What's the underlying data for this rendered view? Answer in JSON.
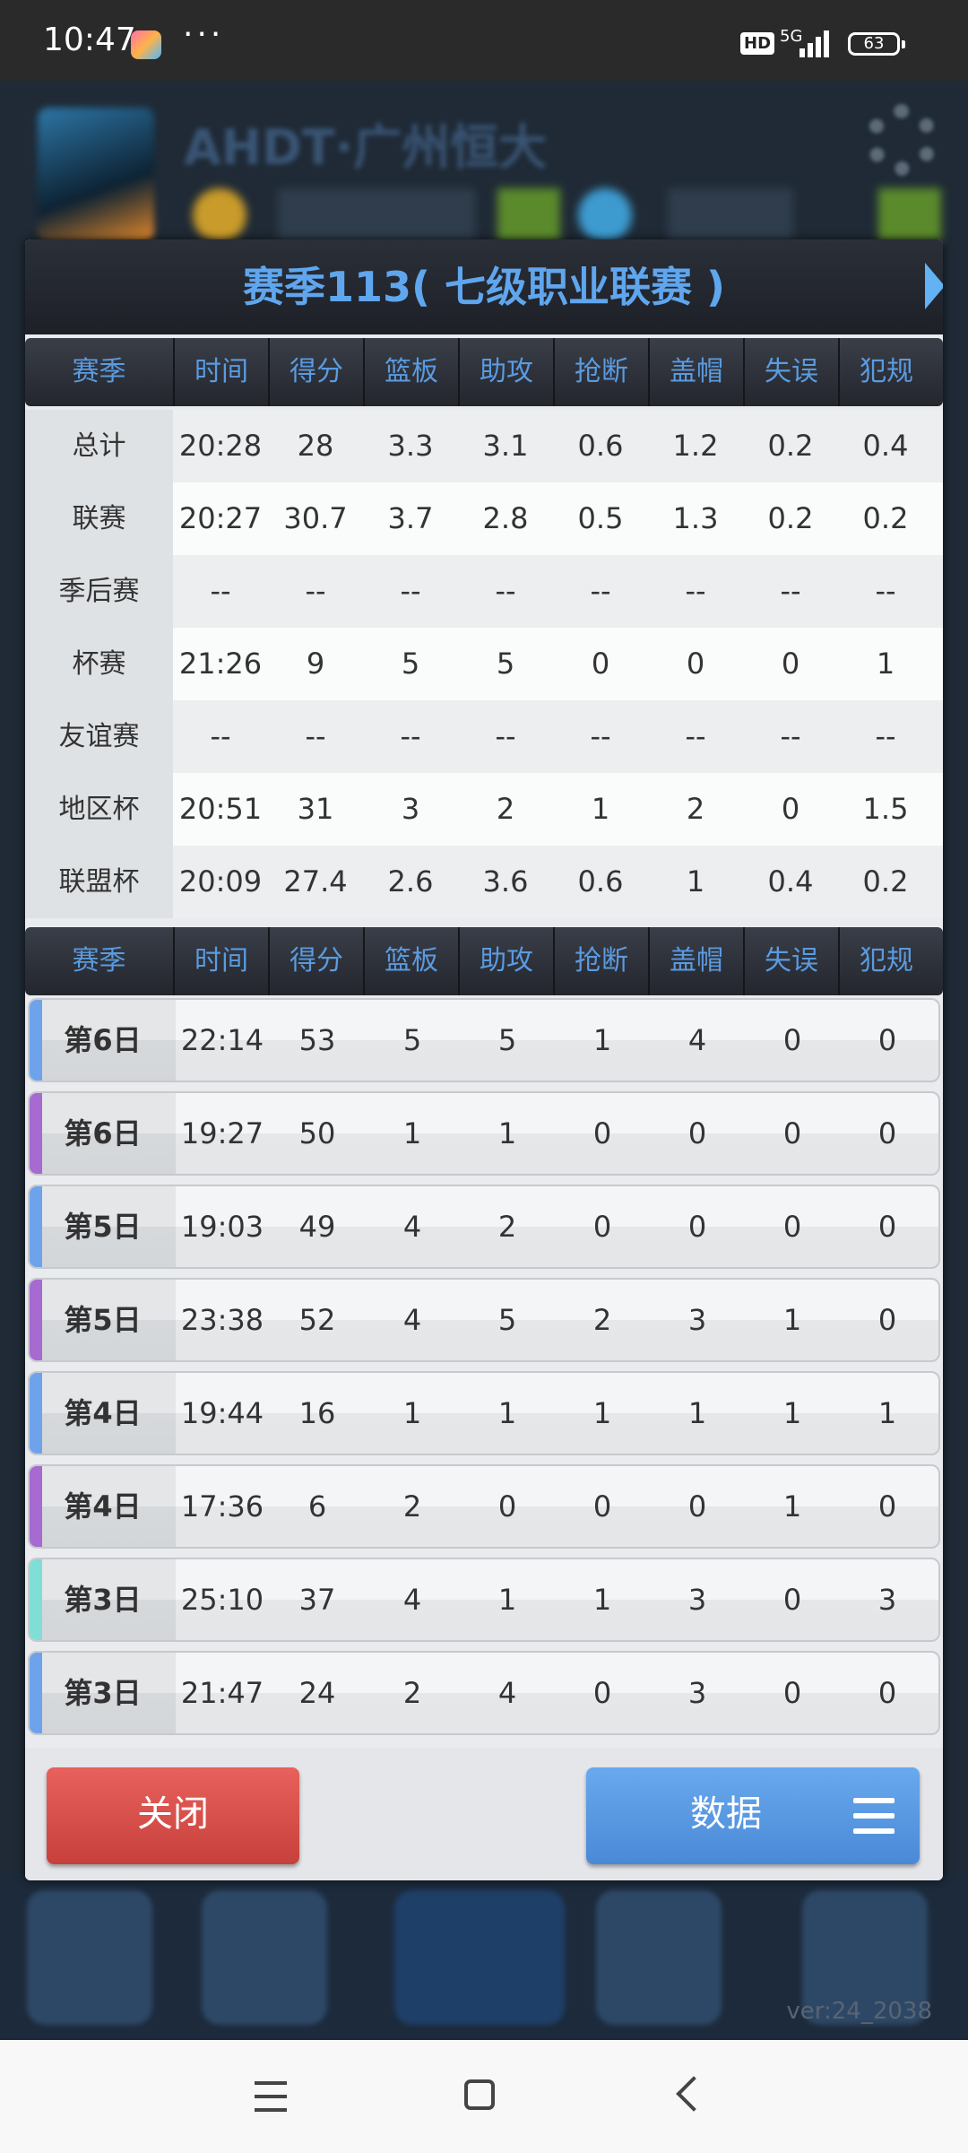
{
  "status_bar": {
    "time": "10:47",
    "dots": "···",
    "hd": "HD",
    "network": "5G",
    "battery": "63"
  },
  "background": {
    "team_title": "AHDT·广州恒大",
    "version": "ver:24_2038"
  },
  "dialog": {
    "title": "赛季113( 七级职业联赛 )",
    "columns": [
      "赛季",
      "时间",
      "得分",
      "篮板",
      "助攻",
      "抢断",
      "盖帽",
      "失误",
      "犯规"
    ],
    "summary_rows": [
      {
        "label": "总计",
        "color": "#7fded6",
        "values": [
          "20:28",
          "28",
          "3.3",
          "3.1",
          "0.6",
          "1.2",
          "0.2",
          "0.4"
        ]
      },
      {
        "label": "联赛",
        "color": "#6ea3ec",
        "values": [
          "20:27",
          "30.7",
          "3.7",
          "2.8",
          "0.5",
          "1.3",
          "0.2",
          "0.2"
        ]
      },
      {
        "label": "季后赛",
        "color": "#e5595a",
        "values": [
          "--",
          "--",
          "--",
          "--",
          "--",
          "--",
          "--",
          "--"
        ]
      },
      {
        "label": "杯赛",
        "color": "#8dc64a",
        "values": [
          "21:26",
          "9",
          "5",
          "5",
          "0",
          "0",
          "0",
          "1"
        ]
      },
      {
        "label": "友谊赛",
        "color": "#f3a33a",
        "values": [
          "--",
          "--",
          "--",
          "--",
          "--",
          "--",
          "--",
          "--"
        ]
      },
      {
        "label": "地区杯",
        "color": "#7fded6",
        "values": [
          "20:51",
          "31",
          "3",
          "2",
          "1",
          "2",
          "0",
          "1.5"
        ]
      },
      {
        "label": "联盟杯",
        "color": "#a66ad0",
        "values": [
          "20:09",
          "27.4",
          "2.6",
          "3.6",
          "0.6",
          "1",
          "0.4",
          "0.2"
        ]
      }
    ],
    "game_rows": [
      {
        "label": "第6日",
        "color": "#6ea3ec",
        "values": [
          "22:14",
          "53",
          "5",
          "5",
          "1",
          "4",
          "0",
          "0"
        ]
      },
      {
        "label": "第6日",
        "color": "#a66ad0",
        "values": [
          "19:27",
          "50",
          "1",
          "1",
          "0",
          "0",
          "0",
          "0"
        ]
      },
      {
        "label": "第5日",
        "color": "#6ea3ec",
        "values": [
          "19:03",
          "49",
          "4",
          "2",
          "0",
          "0",
          "0",
          "0"
        ]
      },
      {
        "label": "第5日",
        "color": "#a66ad0",
        "values": [
          "23:38",
          "52",
          "4",
          "5",
          "2",
          "3",
          "1",
          "0"
        ]
      },
      {
        "label": "第4日",
        "color": "#6ea3ec",
        "values": [
          "19:44",
          "16",
          "1",
          "1",
          "1",
          "1",
          "1",
          "1"
        ]
      },
      {
        "label": "第4日",
        "color": "#a66ad0",
        "values": [
          "17:36",
          "6",
          "2",
          "0",
          "0",
          "0",
          "1",
          "0"
        ]
      },
      {
        "label": "第3日",
        "color": "#7fded6",
        "values": [
          "25:10",
          "37",
          "4",
          "1",
          "1",
          "3",
          "0",
          "3"
        ]
      },
      {
        "label": "第3日",
        "color": "#6ea3ec",
        "values": [
          "21:47",
          "24",
          "2",
          "4",
          "0",
          "3",
          "0",
          "0"
        ]
      }
    ],
    "close_label": "关闭",
    "data_label": "数据"
  }
}
